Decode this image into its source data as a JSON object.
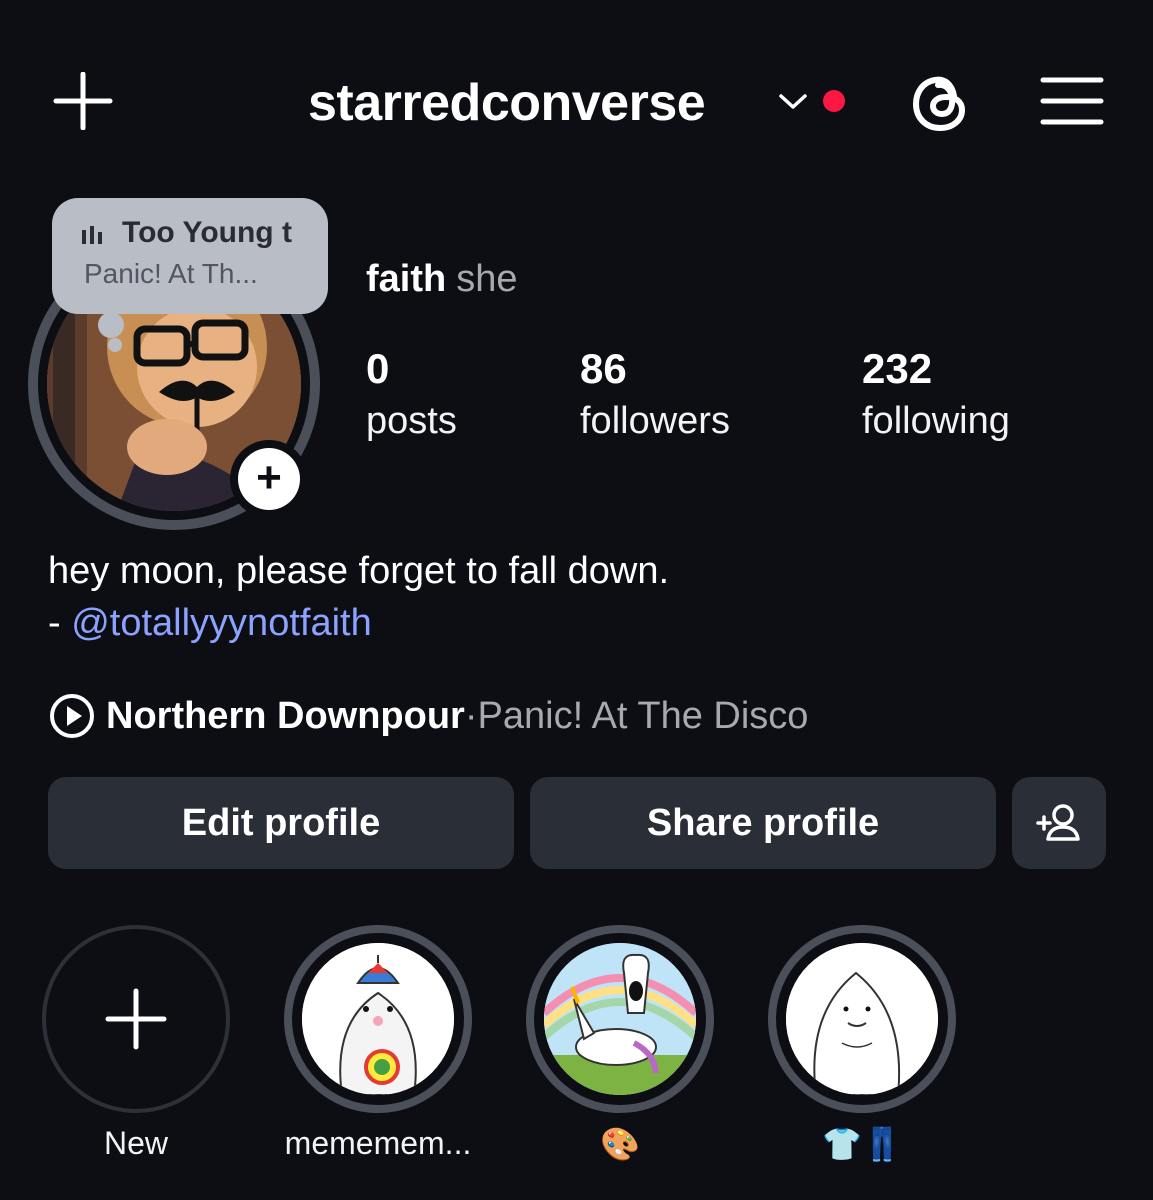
{
  "header": {
    "username": "starredconverse",
    "add_icon": "plus-icon",
    "dropdown_icon": "chevron-down-icon",
    "threads_icon": "threads-icon",
    "menu_icon": "hamburger-menu-icon",
    "notification_color": "#ff1744"
  },
  "music_bubble": {
    "title": "Too Young t",
    "artist": "Panic! At Th..."
  },
  "profile": {
    "name": "faith",
    "pronouns": "she",
    "stats": [
      {
        "value": "0",
        "label": "posts"
      },
      {
        "value": "86",
        "label": "followers"
      },
      {
        "value": "232",
        "label": "following"
      }
    ],
    "bio_line1": "hey moon, please forget to fall down.",
    "bio_prefix": "- ",
    "bio_mention": "@totallyyynotfaith",
    "mention_color": "#8ba2ff",
    "music": {
      "track": "Northern Downpour",
      "separator": " · ",
      "artist": "Panic! At The Disco"
    }
  },
  "actions": {
    "edit_profile": "Edit profile",
    "share_profile": "Share profile",
    "add_person_icon": "add-person-icon"
  },
  "highlights": [
    {
      "label": "New"
    },
    {
      "label": "mememem..."
    },
    {
      "label": "🎨"
    },
    {
      "label": "👕👖"
    }
  ]
}
